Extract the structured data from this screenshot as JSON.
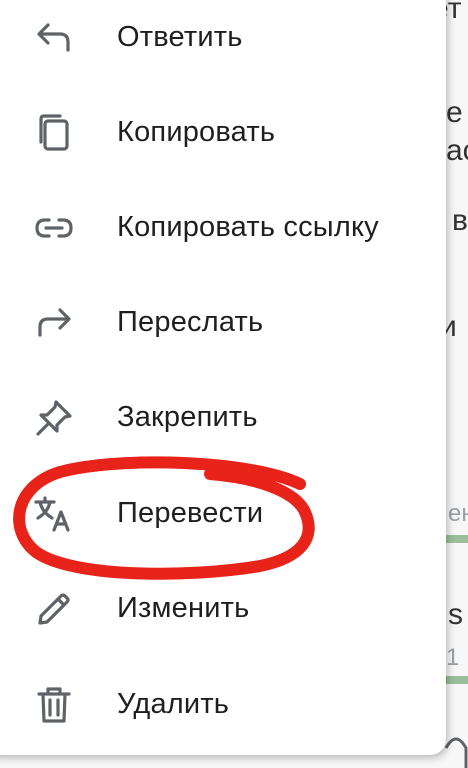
{
  "menu": {
    "items": [
      {
        "label": "Ответить",
        "icon": "reply-icon"
      },
      {
        "label": "Копировать",
        "icon": "copy-icon"
      },
      {
        "label": "Копировать ссылку",
        "icon": "link-icon"
      },
      {
        "label": "Переслать",
        "icon": "forward-icon"
      },
      {
        "label": "Закрепить",
        "icon": "pin-icon"
      },
      {
        "label": "Перевести",
        "icon": "translate-icon"
      },
      {
        "label": "Изменить",
        "icon": "pencil-icon"
      },
      {
        "label": "Удалить",
        "icon": "trash-icon"
      }
    ]
  },
  "background": {
    "fragments": [
      "ет",
      "е",
      "ас",
      "в",
      "и",
      "ен",
      "s",
      "1"
    ]
  },
  "colors": {
    "icon": "#5f6368",
    "text": "#1f1f1f",
    "highlight": "#e8231a",
    "message_bar": "#9bbf9a"
  }
}
